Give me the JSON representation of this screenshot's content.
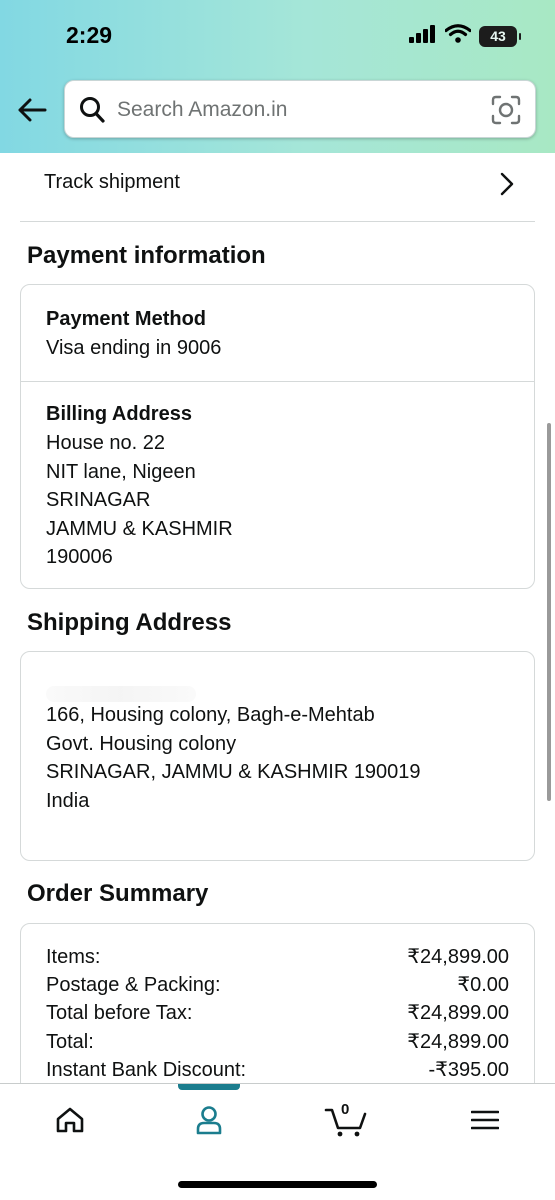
{
  "status": {
    "time": "2:29",
    "battery": "43"
  },
  "search": {
    "placeholder": "Search Amazon.in"
  },
  "track": {
    "label": "Track shipment"
  },
  "payment": {
    "section_title": "Payment information",
    "method_label": "Payment Method",
    "method_value": "Visa ending in 9006",
    "billing_label": "Billing Address",
    "billing_lines": [
      "House no. 22",
      "NIT lane, Nigeen",
      "SRINAGAR",
      "JAMMU & KASHMIR",
      "190006"
    ]
  },
  "shipping": {
    "section_title": "Shipping Address",
    "lines": [
      "166, Housing colony, Bagh-e-Mehtab",
      "Govt. Housing colony",
      "SRINAGAR, JAMMU & KASHMIR 190019",
      "India"
    ]
  },
  "summary": {
    "section_title": "Order Summary",
    "rows": [
      {
        "label": "Items:",
        "value": "₹24,899.00"
      },
      {
        "label": "Postage & Packing:",
        "value": "₹0.00"
      },
      {
        "label": "Total before Tax:",
        "value": "₹24,899.00"
      },
      {
        "label": "Total:",
        "value": "₹24,899.00"
      },
      {
        "label": "Instant Bank Discount:",
        "value": "-₹395.00"
      }
    ]
  },
  "nav": {
    "items": [
      "home-icon",
      "account-icon",
      "cart-icon",
      "menu-icon"
    ],
    "active": "account-icon",
    "cart_count": "0",
    "accent_color": "#1b7d8e"
  }
}
